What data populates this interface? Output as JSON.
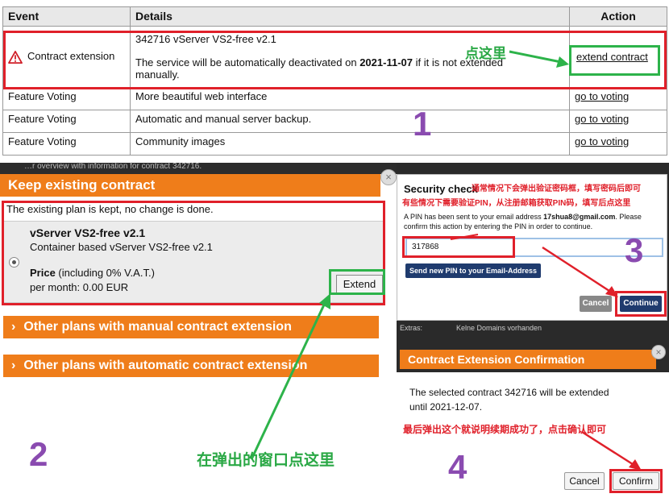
{
  "panel1": {
    "headers": {
      "event": "Event",
      "details": "Details",
      "action": "Action"
    },
    "highlight_row": {
      "event": "Contract extension",
      "details_line1": "342716 vServer VS2-free v2.1",
      "details_pre": "The service will be automatically deactivated on ",
      "details_date": "2021-11-07",
      "details_post": " if it is not extended manually.",
      "action": "extend contract"
    },
    "rows": [
      {
        "event": "Feature Voting",
        "details": "More beautiful web interface",
        "action": "go to voting"
      },
      {
        "event": "Feature Voting",
        "details": "Automatic and manual server backup.",
        "action": "go to voting"
      },
      {
        "event": "Feature Voting",
        "details": "Community images",
        "action": "go to voting"
      }
    ],
    "annotation_cn": "点这里",
    "step_number": "1"
  },
  "panel2": {
    "bg_strip_text": "…r overview with information for contract 342716.",
    "title": "Keep existing contract",
    "description": "The existing plan is kept, no change is done.",
    "plan_name": "vServer VS2-free v2.1",
    "plan_desc": "Container based vServer VS2-free v2.1",
    "price_label": "Price",
    "price_note": " (including 0% V.A.T.)",
    "price_value": "per month: 0.00 EUR",
    "extend_button": "Extend",
    "manual_bar": "Other plans with manual contract extension",
    "auto_bar": "Other plans with automatic contract extension",
    "annotation_cn": "在弹出的窗口点这里",
    "step_number": "2",
    "close_icon": "×"
  },
  "panel3": {
    "title": "Security check",
    "annotation_cn_1": "通常情况下会弹出验证密码框，填写密码后即可",
    "annotation_cn_2": "有些情况下需要验证PIN，从注册邮箱获取PIN码，填写后点这里",
    "info_pre": "A PIN has been sent to your email address ",
    "info_email": "17shua8@gmail.com",
    "info_post": ". Please confirm this action by entering the PIN in order to continue.",
    "pin_value": "317868",
    "send_pin_button": "Send new PIN to your Email-Address",
    "cancel_button": "Cancel",
    "continue_button": "Continue",
    "step_number": "3"
  },
  "panel4": {
    "bg_text": "Kelne Domains vorhanden",
    "bg_label": "Extras:",
    "title": "Contract Extension Confirmation",
    "message": "The selected contract 342716 will be extended until 2021-12-07.",
    "annotation_cn": "最后弹出这个就说明续期成功了，点击确认即可",
    "cancel_button": "Cancel",
    "confirm_button": "Confirm",
    "step_number": "4",
    "close_icon": "×"
  },
  "colors": {
    "accent_orange": "#ef7d1a",
    "highlight_red": "#e0202a",
    "highlight_green": "#2db34a",
    "step_purple": "#8a4bb0",
    "button_navy": "#1f3b6e"
  }
}
